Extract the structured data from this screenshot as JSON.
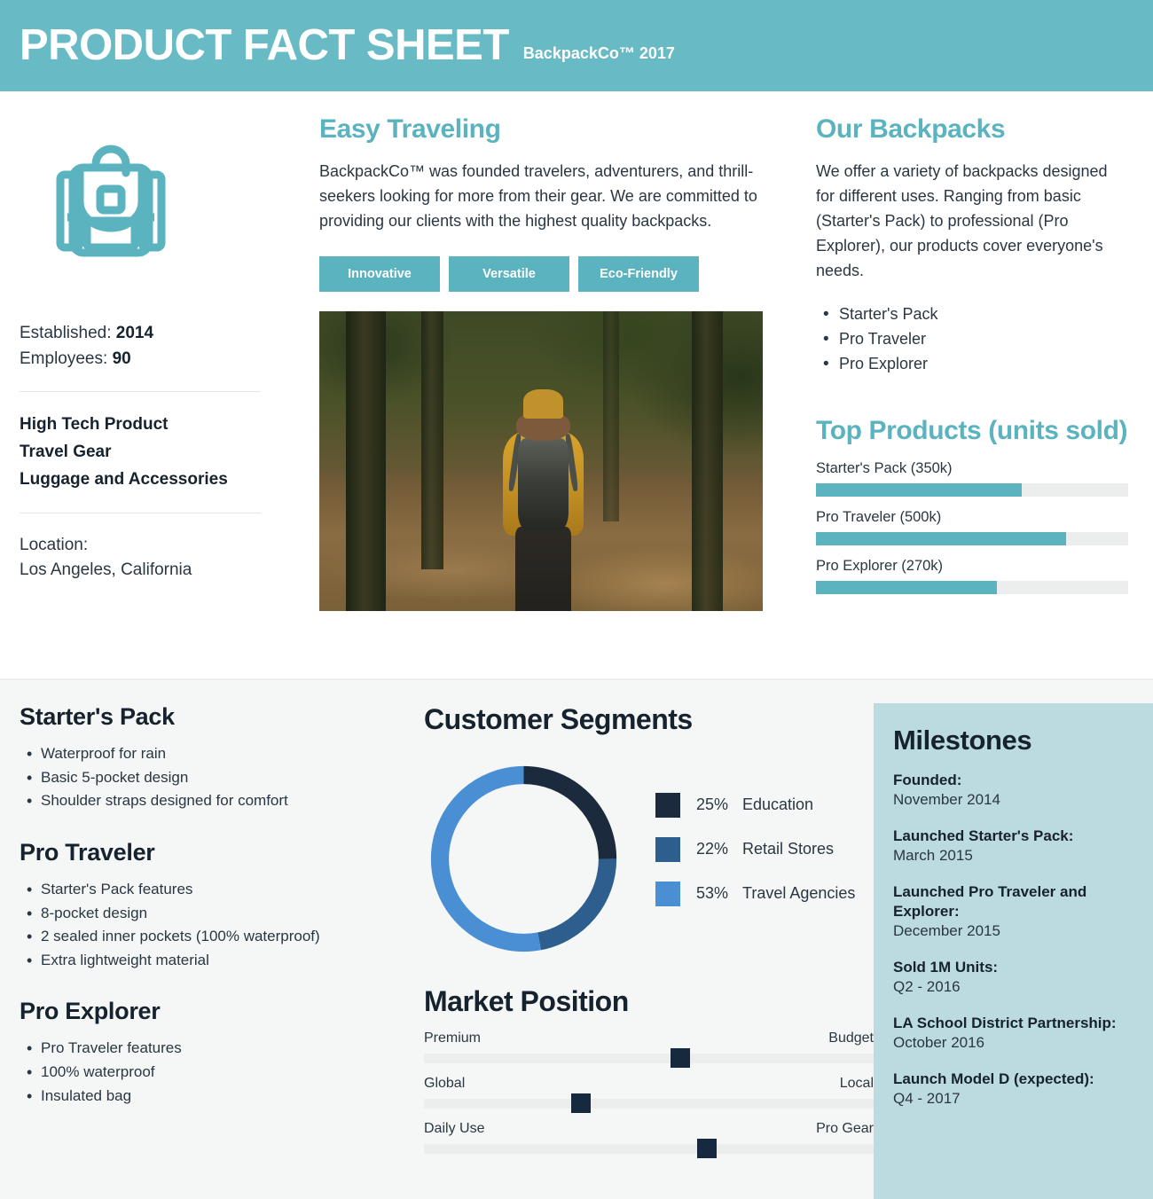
{
  "header": {
    "title": "PRODUCT FACT SHEET",
    "subtitle": "BackpackCo™ 2017",
    "bg_color": "#68bac5"
  },
  "company": {
    "icon": "backpack-icon",
    "established_label": "Established:",
    "established_value": "2014",
    "employees_label": "Employees:",
    "employees_value": "90",
    "categories": [
      "High Tech Product",
      "Travel Gear",
      "Luggage and Accessories"
    ],
    "location_label": "Location:",
    "location_value": "Los Angeles, California"
  },
  "easy_traveling": {
    "heading": "Easy Traveling",
    "body": "BackpackCo™ was founded travelers, adventurers, and thrill-seekers looking for more from their gear. We are committed to providing our clients with the highest quality backpacks.",
    "tags": [
      "Innovative",
      "Versatile",
      "Eco-Friendly"
    ],
    "photo_alt": "hiker-in-forest-photo"
  },
  "our_backpacks": {
    "heading": "Our Backpacks",
    "body": "We offer a variety of backpacks designed for different uses. Ranging from basic (Starter's Pack) to professional (Pro Explorer), our products cover everyone's needs.",
    "items": [
      "Starter's Pack",
      "Pro Traveler",
      "Pro Explorer"
    ]
  },
  "products": [
    {
      "name": "Starter's Pack",
      "features": [
        "Waterproof for rain",
        "Basic 5-pocket design",
        "Shoulder straps designed for comfort"
      ]
    },
    {
      "name": "Pro Traveler",
      "features": [
        "Starter's Pack features",
        "8-pocket design",
        "2 sealed inner pockets (100% waterproof)",
        "Extra lightweight material"
      ]
    },
    {
      "name": "Pro Explorer",
      "features": [
        "Pro Traveler features",
        "100% waterproof",
        "Insulated bag"
      ]
    }
  ],
  "milestones": {
    "title": "Milestones",
    "items": [
      {
        "label": "Founded:",
        "date": "November 2014"
      },
      {
        "label": "Launched Starter's Pack:",
        "date": "March 2015"
      },
      {
        "label": "Launched Pro Traveler and Explorer:",
        "date": "December 2015"
      },
      {
        "label": "Sold 1M Units:",
        "date": "Q2 - 2016"
      },
      {
        "label": "LA School District Partnership:",
        "date": "October 2016"
      },
      {
        "label": "Launch Model D (expected):",
        "date": "Q4 - 2017"
      }
    ]
  },
  "chart_data": [
    {
      "type": "bar",
      "title": "Top Products (units sold)",
      "orientation": "horizontal",
      "categories": [
        "Starter's Pack",
        "Pro Traveler",
        "Pro Explorer"
      ],
      "labels": [
        "Starter's Pack (350k)",
        "Pro Traveler (500k)",
        "Pro Explorer (270k)"
      ],
      "values": [
        350,
        500,
        270
      ],
      "unit": "k units",
      "bar_percents": [
        66,
        80,
        58
      ],
      "bar_color": "#5ab3bf",
      "track_color": "#eceeed",
      "xlabel": "",
      "ylabel": "",
      "grid": false,
      "legend": "none"
    },
    {
      "type": "pie",
      "title": "Customer Segments",
      "subtype": "donut",
      "categories": [
        "Education",
        "Retail Stores",
        "Travel Agencies"
      ],
      "values": [
        25,
        22,
        53
      ],
      "unit": "%",
      "colors": [
        "#1b2b3d",
        "#2e5e8e",
        "#4a8fd4"
      ],
      "legend": "right",
      "legend_entries": [
        {
          "percent": "25%",
          "label": "Education",
          "color": "#1b2b3d"
        },
        {
          "percent": "22%",
          "label": "Retail Stores",
          "color": "#2e5e8e"
        },
        {
          "percent": "53%",
          "label": "Travel Agencies",
          "color": "#4a8fd4"
        }
      ]
    },
    {
      "type": "bar",
      "title": "Market Position",
      "subtype": "slider-scale",
      "marker_color": "#16293f",
      "track_color": "#eceeed",
      "scales": [
        {
          "left_label": "Premium",
          "right_label": "Budget",
          "position": 57
        },
        {
          "left_label": "Global",
          "right_label": "Local",
          "position": 35
        },
        {
          "left_label": "Daily Use",
          "right_label": "Pro Gear",
          "position": 63
        }
      ]
    }
  ]
}
